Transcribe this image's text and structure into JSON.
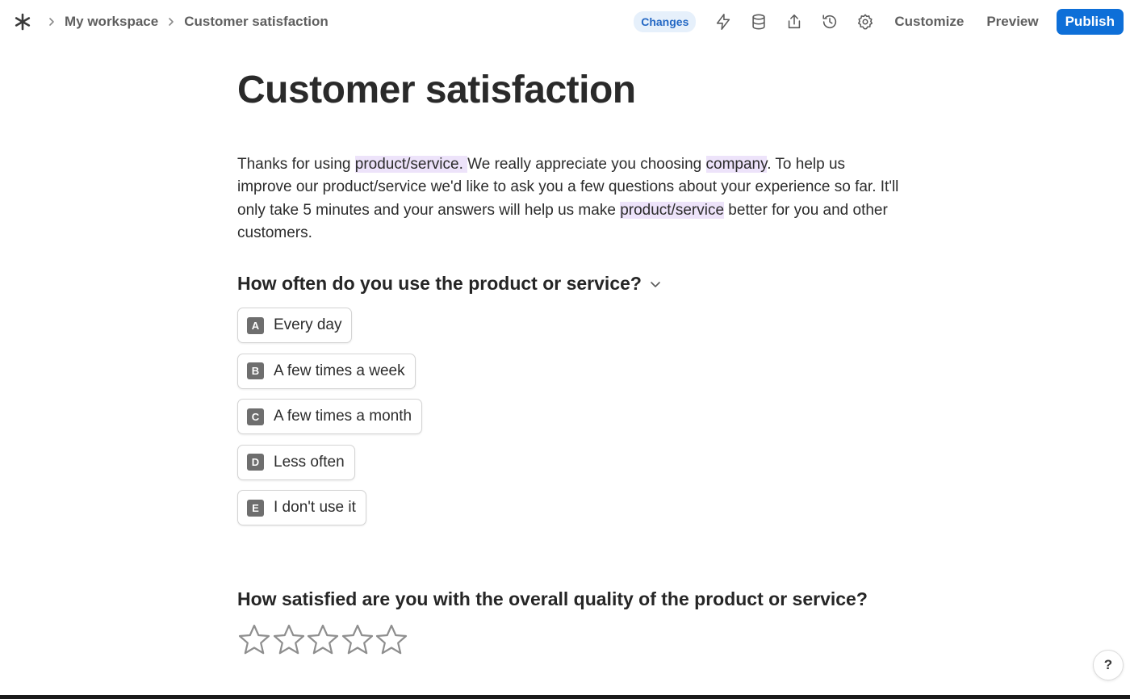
{
  "breadcrumb": {
    "items": [
      "My workspace",
      "Customer satisfaction"
    ]
  },
  "toolbar": {
    "changes_badge": "Changes",
    "customize_label": "Customize",
    "preview_label": "Preview",
    "publish_label": "Publish",
    "icons": [
      "bolt-icon",
      "database-icon",
      "share-icon",
      "history-icon",
      "gear-icon"
    ]
  },
  "form": {
    "title": "Customer satisfaction",
    "intro": {
      "p1": "Thanks for using ",
      "hl1": "product/service. ",
      "p2": "We really appreciate you choosing ",
      "hl2": "company",
      "p3": ". To help us improve our product/service we'd like to ask you a few questions about your experience so far. It'll only take 5 minutes and your answers will help us make ",
      "hl3": "product/service",
      "p4": " better for you and other customers."
    },
    "question1": {
      "text": "How often do you use the product or service?",
      "options": [
        {
          "key": "A",
          "label": "Every day"
        },
        {
          "key": "B",
          "label": "A few times a week"
        },
        {
          "key": "C",
          "label": "A few times a month"
        },
        {
          "key": "D",
          "label": "Less often"
        },
        {
          "key": "E",
          "label": "I don't use it"
        }
      ]
    },
    "question2": {
      "text": "How satisfied are you with the overall quality of the product or service?",
      "rating_max": 5,
      "rating_value": 0
    }
  },
  "help_label": "?",
  "colors": {
    "accent": "#0e6fd8",
    "highlight": "#ede3fa",
    "badge_bg": "#e6f0fb",
    "badge_text": "#2468c4"
  }
}
